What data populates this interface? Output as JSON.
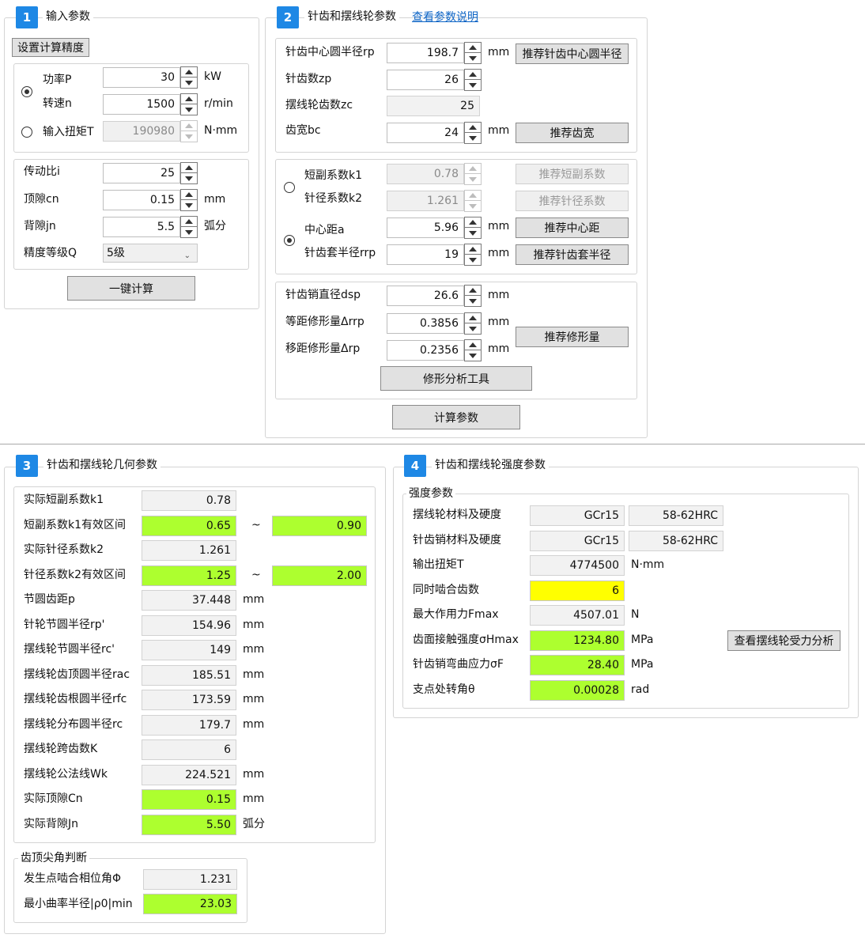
{
  "panel1": {
    "num": "1",
    "title": "输入参数",
    "precision_button": "设置计算精度",
    "power_label": "功率P",
    "power_value": "30",
    "power_unit": "kW",
    "speed_label": "转速n",
    "speed_value": "1500",
    "speed_unit": "r/min",
    "torque_label": "输入扭矩T",
    "torque_value": "190980",
    "torque_unit": "N·mm",
    "ratio_label": "传动比i",
    "ratio_value": "25",
    "clearance_label": "顶隙cn",
    "clearance_value": "0.15",
    "clearance_unit": "mm",
    "backlash_label": "背隙jn",
    "backlash_value": "5.5",
    "backlash_unit": "弧分",
    "grade_label": "精度等级Q",
    "grade_value": "5级",
    "calc_button": "一键计算"
  },
  "panel2": {
    "num": "2",
    "title": "针齿和摆线轮参数",
    "help_link": "查看参数说明",
    "rp_label": "针齿中心圆半径rp",
    "rp_value": "198.7",
    "rp_unit": "mm",
    "rp_button": "推荐针齿中心圆半径",
    "zp_label": "针齿数zp",
    "zp_value": "26",
    "zc_label": "摆线轮齿数zc",
    "zc_value": "25",
    "bc_label": "齿宽bc",
    "bc_value": "24",
    "bc_unit": "mm",
    "bc_button": "推荐齿宽",
    "k1_label": "短副系数k1",
    "k1_value": "0.78",
    "k1_button": "推荐短副系数",
    "k2_label": "针径系数k2",
    "k2_value": "1.261",
    "k2_button": "推荐针径系数",
    "a_label": "中心距a",
    "a_value": "5.96",
    "a_unit": "mm",
    "a_button": "推荐中心距",
    "rrp_label": "针齿套半径rrp",
    "rrp_value": "19",
    "rrp_unit": "mm",
    "rrp_button": "推荐针齿套半径",
    "dsp_label": "针齿销直径dsp",
    "dsp_value": "26.6",
    "dsp_unit": "mm",
    "drrp_label": "等距修形量Δrrp",
    "drrp_value": "0.3856",
    "drrp_unit": "mm",
    "drp_label": "移距修形量Δrp",
    "drp_value": "0.2356",
    "drp_unit": "mm",
    "mod_button": "推荐修形量",
    "tool_button": "修形分析工具",
    "calc_button": "计算参数"
  },
  "panel3": {
    "num": "3",
    "title": "针齿和摆线轮几何参数",
    "rows": [
      {
        "label": "实际短副系数k1",
        "value": "0.78",
        "unit": "",
        "style": "ro"
      },
      {
        "label": "短副系数k1有效区间",
        "value": "0.65",
        "unit": "",
        "style": "green",
        "value2": "0.90"
      },
      {
        "label": "实际针径系数k2",
        "value": "1.261",
        "unit": "",
        "style": "ro"
      },
      {
        "label": "针径系数k2有效区间",
        "value": "1.25",
        "unit": "",
        "style": "green",
        "value2": "2.00"
      },
      {
        "label": "节圆齿距p",
        "value": "37.448",
        "unit": "mm",
        "style": "ro"
      },
      {
        "label": "针轮节圆半径rp'",
        "value": "154.96",
        "unit": "mm",
        "style": "ro"
      },
      {
        "label": "摆线轮节圆半径rc'",
        "value": "149",
        "unit": "mm",
        "style": "ro"
      },
      {
        "label": "摆线轮齿顶圆半径rac",
        "value": "185.51",
        "unit": "mm",
        "style": "ro"
      },
      {
        "label": "摆线轮齿根圆半径rfc",
        "value": "173.59",
        "unit": "mm",
        "style": "ro"
      },
      {
        "label": "摆线轮分布圆半径rc",
        "value": "179.7",
        "unit": "mm",
        "style": "ro"
      },
      {
        "label": "摆线轮跨齿数K",
        "value": "6",
        "unit": "",
        "style": "ro"
      },
      {
        "label": "摆线轮公法线Wk",
        "value": "224.521",
        "unit": "mm",
        "style": "ro"
      },
      {
        "label": "实际顶隙Cn",
        "value": "0.15",
        "unit": "mm",
        "style": "green"
      },
      {
        "label": "实际背隙Jn",
        "value": "5.50",
        "unit": "弧分",
        "style": "green"
      }
    ],
    "tilde": "~",
    "tip_title": "齿顶尖角判断",
    "phase_label": "发生点啮合相位角Φ",
    "phase_value": "1.231",
    "rho_label": "最小曲率半径|ρ0|min",
    "rho_value": "23.03"
  },
  "panel4": {
    "num": "4",
    "title": "针齿和摆线轮强度参数",
    "group_title": "强度参数",
    "mat1_label": "摆线轮材料及硬度",
    "mat1_value": "GCr15",
    "mat1_hard": "58-62HRC",
    "mat2_label": "针齿销材料及硬度",
    "mat2_value": "GCr15",
    "mat2_hard": "58-62HRC",
    "torque_label": "输出扭矩T",
    "torque_value": "4774500",
    "torque_unit": "N·mm",
    "teeth_label": "同时啮合齿数",
    "teeth_value": "6",
    "force_label": "最大作用力Fmax",
    "force_value": "4507.01",
    "force_unit": "N",
    "contact_label": "齿面接触强度σHmax",
    "contact_value": "1234.80",
    "contact_unit": "MPa",
    "bend_label": "针齿销弯曲应力σF",
    "bend_value": "28.40",
    "bend_unit": "MPa",
    "angle_label": "支点处转角θ",
    "angle_value": "0.00028",
    "angle_unit": "rad",
    "force_button": "查看摆线轮受力分析"
  },
  "colors": {
    "accent": "#1e88e5",
    "green": "#adff2f",
    "yellow": "#ffff00"
  }
}
